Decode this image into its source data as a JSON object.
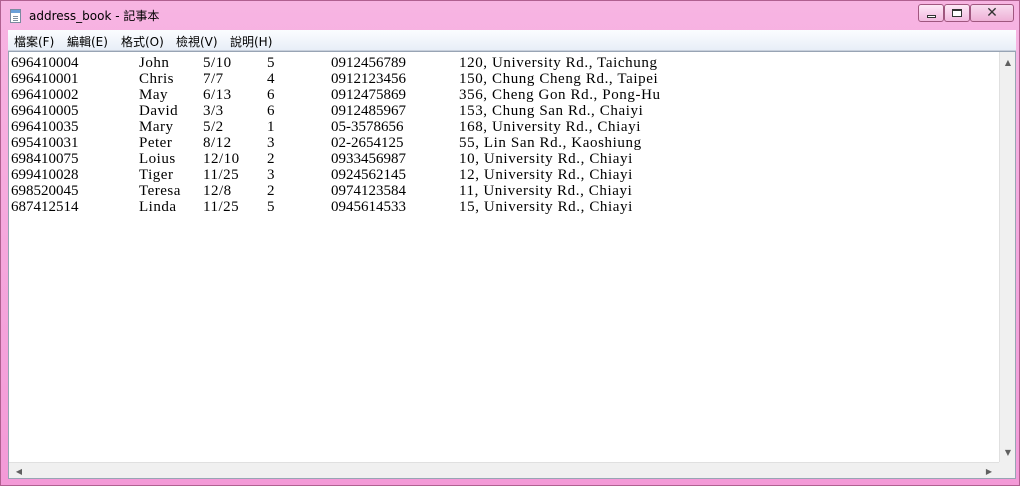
{
  "window": {
    "title": "address_book - 記事本",
    "controls": {
      "minimize": "minimize",
      "maximize": "maximize",
      "close": "✕"
    }
  },
  "menu": [
    "檔案(F)",
    "編輯(E)",
    "格式(O)",
    "檢視(V)",
    "說明(H)"
  ],
  "rows": [
    {
      "id": "696410004",
      "name": "John",
      "date": "5/10",
      "num": "5",
      "phone": "0912456789",
      "address": "120, University Rd., Taichung"
    },
    {
      "id": "696410001",
      "name": "Chris",
      "date": "7/7",
      "num": "4",
      "phone": "0912123456",
      "address": "150, Chung Cheng Rd., Taipei"
    },
    {
      "id": "696410002",
      "name": "May",
      "date": "6/13",
      "num": "6",
      "phone": "0912475869",
      "address": "356, Cheng Gon Rd., Pong-Hu"
    },
    {
      "id": "696410005",
      "name": "David",
      "date": "3/3",
      "num": "6",
      "phone": "0912485967",
      "address": "153, Chung San Rd., Chaiyi"
    },
    {
      "id": "696410035",
      "name": "Mary",
      "date": "5/2",
      "num": "1",
      "phone": "05-3578656",
      "address": "168, University Rd., Chiayi"
    },
    {
      "id": "695410031",
      "name": "Peter",
      "date": "8/12",
      "num": "3",
      "phone": "02-2654125",
      "address": "55, Lin San Rd., Kaoshiung"
    },
    {
      "id": "698410075",
      "name": "Loius",
      "date": "12/10",
      "num": "2",
      "phone": "0933456987",
      "address": "10, University Rd., Chiayi"
    },
    {
      "id": "699410028",
      "name": "Tiger",
      "date": "11/25",
      "num": "3",
      "phone": "0924562145",
      "address": "12, University Rd., Chiayi"
    },
    {
      "id": "698520045",
      "name": "Teresa",
      "date": "12/8",
      "num": "2",
      "phone": "0974123584",
      "address": "11, University Rd., Chiayi"
    },
    {
      "id": "687412514",
      "name": "Linda",
      "date": "11/25",
      "num": "5",
      "phone": "0945614533",
      "address": "15, University Rd., Chiayi"
    }
  ],
  "scrollbar": {
    "up": "▲",
    "down": "▼",
    "left": "◀",
    "right": "▶"
  }
}
